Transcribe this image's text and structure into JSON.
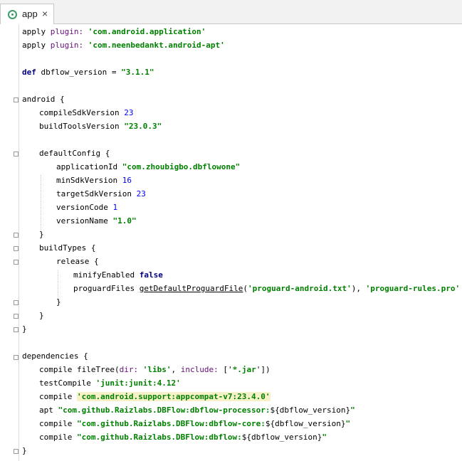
{
  "tab": {
    "label": "app",
    "close": "×"
  },
  "code": {
    "l1": {
      "a": "apply ",
      "b": "plugin: ",
      "c": "'com.android.application'"
    },
    "l2": {
      "a": "apply ",
      "b": "plugin: ",
      "c": "'com.neenbedankt.android-apt'"
    },
    "l4": {
      "a": "def",
      "b": " dbflow_version = ",
      "c": "\"3.1.1\""
    },
    "l6": {
      "a": "android {"
    },
    "l7": {
      "a": "compileSdkVersion ",
      "b": "23"
    },
    "l8": {
      "a": "buildToolsVersion ",
      "b": "\"23.0.3\""
    },
    "l10": {
      "a": "defaultConfig {"
    },
    "l11": {
      "a": "applicationId ",
      "b": "\"com.zhoubigbo.dbflowone\""
    },
    "l12": {
      "a": "minSdkVersion ",
      "b": "16"
    },
    "l13": {
      "a": "targetSdkVersion ",
      "b": "23"
    },
    "l14": {
      "a": "versionCode ",
      "b": "1"
    },
    "l15": {
      "a": "versionName ",
      "b": "\"1.0\""
    },
    "l16": {
      "a": "}"
    },
    "l17": {
      "a": "buildTypes {"
    },
    "l18": {
      "a": "release {"
    },
    "l19": {
      "a": "minifyEnabled ",
      "b": "false"
    },
    "l20": {
      "a": "proguardFiles ",
      "b": "getDefaultProguardFile",
      "c": "(",
      "d": "'proguard-android.txt'",
      "e": "), ",
      "f": "'proguard-rules.pro'"
    },
    "l21": {
      "a": "}"
    },
    "l22": {
      "a": "}"
    },
    "l23": {
      "a": "}"
    },
    "l25": {
      "a": "dependencies {"
    },
    "l26": {
      "a": "compile fileTree(",
      "b": "dir: ",
      "c": "'libs'",
      "d": ", ",
      "e": "include: ",
      "f": "['",
      "g": "*.jar",
      "h": "'])"
    },
    "l27": {
      "a": "testCompile ",
      "b": "'junit:junit:4.12'"
    },
    "l28": {
      "a": "compile ",
      "b": "'com.android.support:appcompat-v7:23.4.0'"
    },
    "l29": {
      "a": "apt ",
      "b": "\"com.github.Raizlabs.DBFlow:dbflow-processor:",
      "c": "${dbflow_version}",
      "d": "\""
    },
    "l30": {
      "a": "compile ",
      "b": "\"com.github.Raizlabs.DBFlow:dbflow-core:",
      "c": "${dbflow_version}",
      "d": "\""
    },
    "l31": {
      "a": "compile ",
      "b": "\"com.github.Raizlabs.DBFlow:dbflow:",
      "c": "${dbflow_version}",
      "d": "\""
    },
    "l32": {
      "a": "}"
    }
  },
  "colors": {
    "keyword": "#000080",
    "string": "#008000",
    "number": "#0000ff",
    "named_arg": "#660e7a",
    "highlight": "#f7f1c7"
  }
}
